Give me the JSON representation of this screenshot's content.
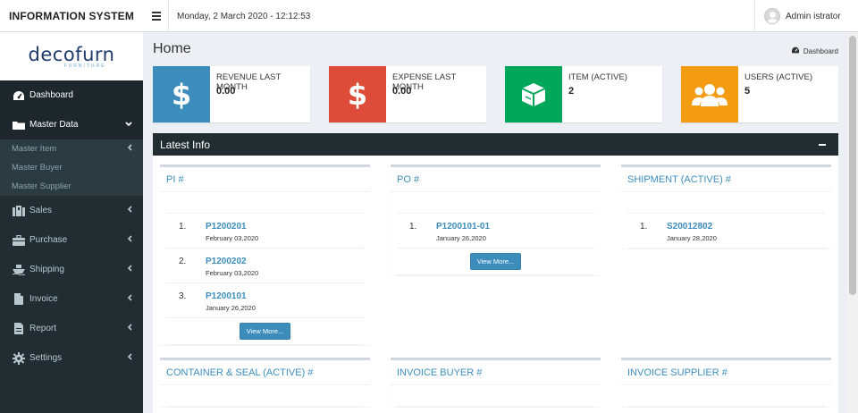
{
  "app": {
    "title": "INFORMATION SYSTEM",
    "datetime": "Monday, 2 March 2020 - 12:12:53",
    "user": "Admin istrator"
  },
  "logo": {
    "name": "decofurn",
    "sub": "FURNITURE"
  },
  "sidebar": {
    "items": [
      {
        "label": "Dashboard",
        "icon": "dashboard-icon"
      },
      {
        "label": "Master Data",
        "icon": "folder-icon"
      },
      {
        "label": "Sales",
        "icon": "sales-icon"
      },
      {
        "label": "Purchase",
        "icon": "briefcase-icon"
      },
      {
        "label": "Shipping",
        "icon": "ship-icon"
      },
      {
        "label": "Invoice",
        "icon": "file-icon"
      },
      {
        "label": "Report",
        "icon": "report-icon"
      },
      {
        "label": "Settings",
        "icon": "gear-icon"
      }
    ],
    "submenu": [
      "Master Item",
      "Master Buyer",
      "Master Supplier"
    ]
  },
  "page": {
    "title": "Home",
    "breadcrumb": "Dashboard"
  },
  "info_boxes": [
    {
      "label": "REVENUE LAST MONTH",
      "value": "0.00",
      "color": "#3c8dbc",
      "icon": "dollar-icon"
    },
    {
      "label": "EXPENSE LAST MONTH",
      "value": "0.00",
      "color": "#dd4b39",
      "icon": "dollar-icon"
    },
    {
      "label": "ITEM (ACTIVE)",
      "value": "2",
      "color": "#00a65a",
      "icon": "cube-icon"
    },
    {
      "label": "USERS (ACTIVE)",
      "value": "5",
      "color": "#f39c12",
      "icon": "users-icon"
    }
  ],
  "latest_info": {
    "title": "Latest Info",
    "pi": {
      "title": "PI #",
      "rows": [
        {
          "num": "1.",
          "code": "P1200201",
          "date": "February 03,2020"
        },
        {
          "num": "2.",
          "code": "P1200202",
          "date": "February 03,2020"
        },
        {
          "num": "3.",
          "code": "P1200101",
          "date": "January 26,2020"
        }
      ],
      "button": "View More..."
    },
    "po": {
      "title": "PO #",
      "rows": [
        {
          "num": "1.",
          "code": "P1200101-01",
          "date": "January 26,2020"
        }
      ],
      "button": "View More..."
    },
    "shipment": {
      "title": "SHIPMENT (ACTIVE) #",
      "rows": [
        {
          "num": "1.",
          "code": "S20012802",
          "date": "January 28,2020"
        }
      ]
    },
    "container": {
      "title": "CONTAINER & SEAL (ACTIVE) #"
    },
    "invoice_buyer": {
      "title": "INVOICE BUYER #"
    },
    "invoice_supplier": {
      "title": "INVOICE SUPPLIER #"
    }
  }
}
